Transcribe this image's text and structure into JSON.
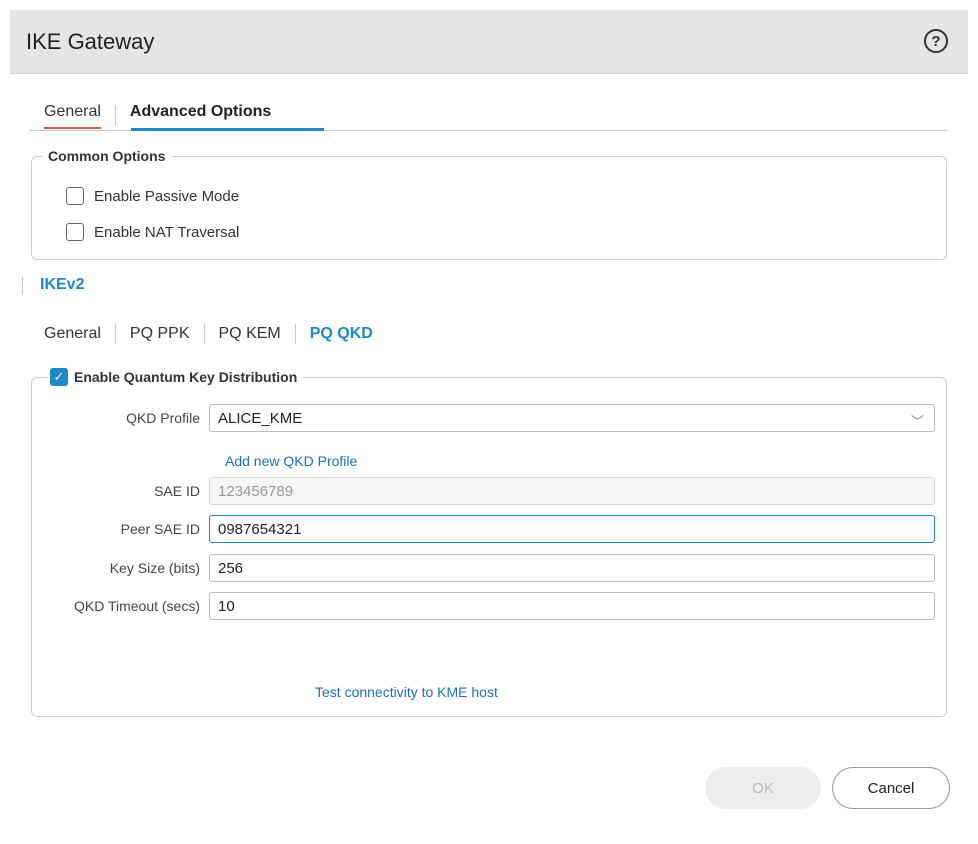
{
  "window": {
    "title": "IKE Gateway",
    "help_icon": "?"
  },
  "tabs": {
    "general": "General",
    "advanced": "Advanced Options"
  },
  "common_options": {
    "legend": "Common Options",
    "passive_mode": "Enable Passive Mode",
    "nat_traversal": "Enable NAT Traversal"
  },
  "ikev2": {
    "title": "IKEv2",
    "subtabs": [
      "General",
      "PQ PPK",
      "PQ KEM",
      "PQ QKD"
    ]
  },
  "qkd": {
    "legend": "Enable Quantum Key Distribution",
    "checkmark": "✓",
    "profile_label": "QKD Profile",
    "profile_value": "ALICE_KME",
    "chevron": "﹀",
    "add_profile_link": "Add new QKD Profile",
    "sae_id_label": "SAE ID",
    "sae_id_placeholder": "123456789",
    "peer_sae_id_label": "Peer SAE ID",
    "peer_sae_id_value": "0987654321",
    "key_size_label": "Key Size (bits)",
    "key_size_value": "256",
    "timeout_label": "QKD Timeout (secs)",
    "timeout_value": "10",
    "test_link": "Test connectivity to KME host"
  },
  "buttons": {
    "ok": "OK",
    "cancel": "Cancel"
  },
  "colors": {
    "accent": "#1e88c8",
    "link": "#1e6fc0",
    "tab_underline_red": "#e05a4a"
  }
}
